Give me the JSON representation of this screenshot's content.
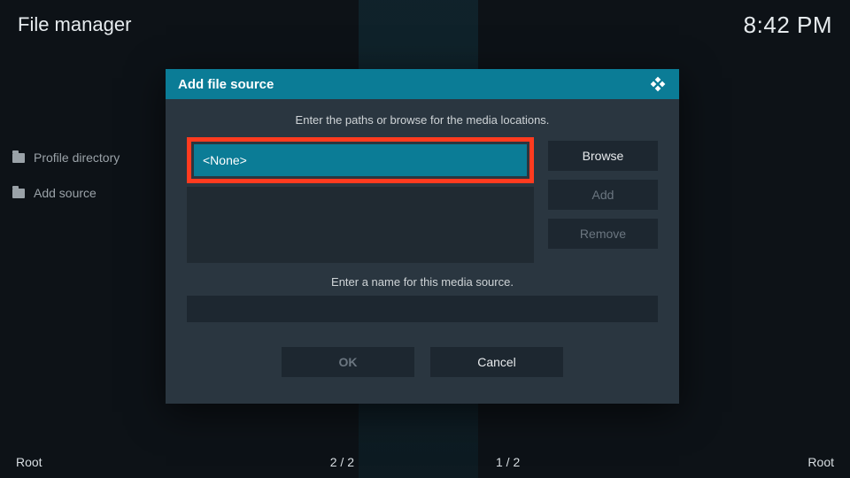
{
  "header": {
    "title": "File manager",
    "clock": "8:42 PM"
  },
  "bg_list": {
    "items": [
      {
        "label": "Profile directory"
      },
      {
        "label": "Add source"
      }
    ]
  },
  "dialog": {
    "title": "Add file source",
    "instruction": "Enter the paths or browse for the media locations.",
    "path_value": "<None>",
    "browse_label": "Browse",
    "add_label": "Add",
    "remove_label": "Remove",
    "name_instruction": "Enter a name for this media source.",
    "name_value": "",
    "ok_label": "OK",
    "cancel_label": "Cancel"
  },
  "footer": {
    "left": "Root",
    "center_left": "2 / 2",
    "center_right": "1 / 2",
    "right": "Root"
  }
}
